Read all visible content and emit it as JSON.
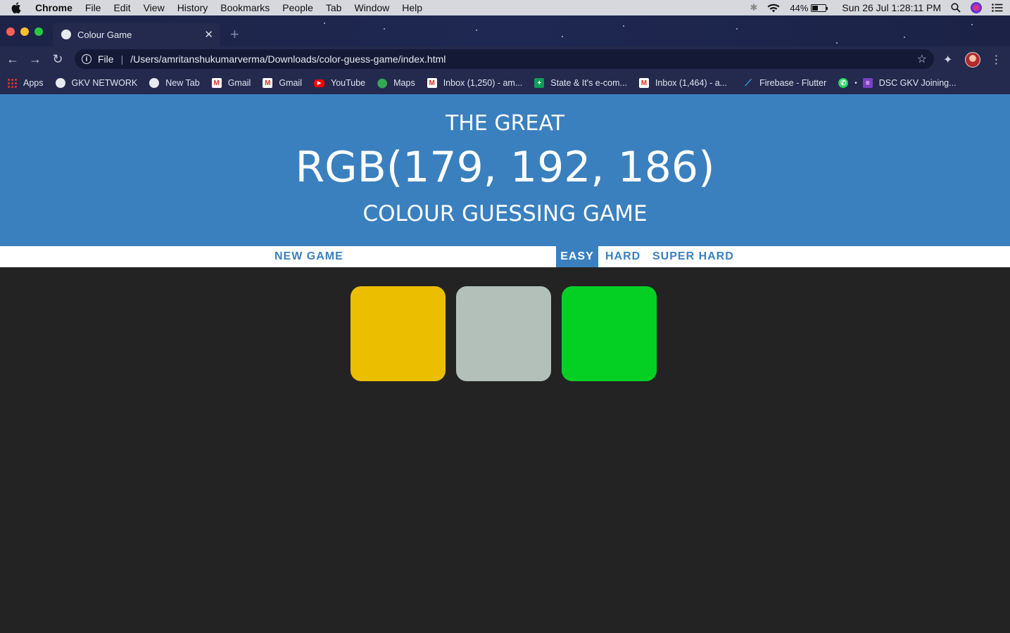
{
  "menubar": {
    "app": "Chrome",
    "items": [
      "File",
      "Edit",
      "View",
      "History",
      "Bookmarks",
      "People",
      "Tab",
      "Window",
      "Help"
    ],
    "battery": "44%",
    "clock": "Sun 26 Jul  1:28:11 PM"
  },
  "tab": {
    "title": "Colour Game"
  },
  "omnibox": {
    "scheme": "File",
    "url": "/Users/amritanshukumarverma/Downloads/color-guess-game/index.html"
  },
  "bookmarks": [
    {
      "label": "Apps",
      "icon": "apps-grid-icon"
    },
    {
      "label": "GKV NETWORK",
      "icon": "globe-icon"
    },
    {
      "label": "New Tab",
      "icon": "globe-icon"
    },
    {
      "label": "Gmail",
      "icon": "gmail-icon"
    },
    {
      "label": "Gmail",
      "icon": "gmail-icon"
    },
    {
      "label": "YouTube",
      "icon": "youtube-icon"
    },
    {
      "label": "Maps",
      "icon": "maps-pin-icon"
    },
    {
      "label": "Inbox (1,250) - am...",
      "icon": "gmail-icon"
    },
    {
      "label": "State & It's e-com...",
      "icon": "sheets-icon"
    },
    {
      "label": "Inbox (1,464) - a...",
      "icon": "gmail-icon"
    },
    {
      "label": "Firebase - Flutter",
      "icon": "flutter-icon"
    },
    {
      "label": "",
      "icon": "whatsapp-icon"
    },
    {
      "label": "DSC GKV Joining...",
      "icon": "forms-icon"
    }
  ],
  "header": {
    "line1": "THE GREAT",
    "target": "RGB(179, 192, 186)",
    "line3": "COLOUR GUESSING GAME",
    "color": "#3a80bf"
  },
  "controls": {
    "new_game": "NEW GAME",
    "modes": [
      "EASY",
      "HARD",
      "SUPER HARD"
    ],
    "selected_mode": "EASY"
  },
  "squares": [
    {
      "color": "#ebbf00"
    },
    {
      "color": "#b3c0ba"
    },
    {
      "color": "#04d024"
    }
  ]
}
